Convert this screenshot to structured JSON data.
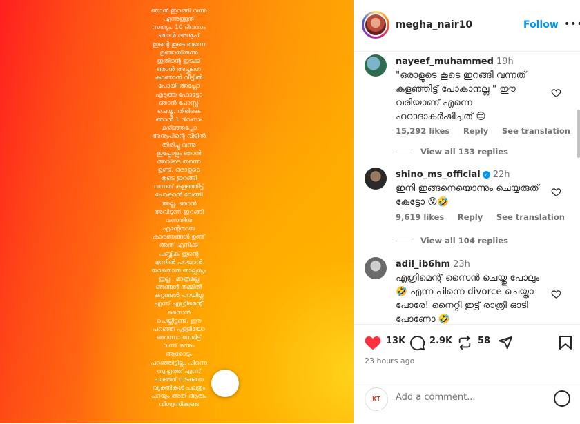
{
  "post_text_lines": [
    "ഞാൻ ഇറങ്ങി വന്നു",
    "എന്നുള്ളത്",
    "സത്യം. 10 ദിവസം",
    "ഞാൻ അനൂപ്",
    "ഇന്റെ കൂടെ തന്നെ",
    "ഉണ്ടായിരുന്നു",
    "ഇതിന്റെ ഇടക്ക്",
    "ഞാൻ അച്ഛനെ",
    "കാണാൻ വീട്ടിൽ",
    "പോയി അപ്പോ",
    "എടുത്ത ഫോട്ടോ",
    "ഞാൻ പോസ്റ്റ്",
    "ചെയ്തു. തിരികെ",
    "ഞാൻ 1 ദിവസം",
    "കഴിഞ്ഞപ്പോ",
    "അനൂപിന്റെ വീട്ടിൽ",
    "തിരിച്ചു വന്നു",
    "ഇപ്പോളും ഞാൻ",
    "അവിടെ തന്നെ",
    "ഉണ്ട്. ഒരാളുടെ",
    "കൂടെ ഇറങ്ങി",
    "വന്നത് കളഞ്ഞിട്ട്",
    "പോകാൻ വേണ്ടി",
    "അല്ല. ഞാൻ",
    "അവിടുന്ന് ഇറങ്ങി",
    "വന്നതിനു",
    "എന്റേതായ",
    "കാരണങ്ങൾ ഉണ്ട്",
    "അത് എനിക്ക്",
    "പബ്ലിക് ഇന്റെ",
    "മുന്നിൽ പറയാൻ",
    "യാതൊരു താല്പര്യം",
    "ഇല്ല . മാത്രമല്ല",
    "ഞങ്ങൾ തമ്മിൽ",
    "കുറ്റങ്ങൾ പറയില്ല",
    "എന്ന് എഗ്രിമെന്റ്",
    "സൈൻ",
    "ചെയ്തിട്ടുണ്ട്. ഈ",
    "പറഞ്ഞ പുള്ളിയോ",
    "ഞാനോ നേരിട്ട്",
    "വന്ന് ഒന്നും",
    "ആരോടും",
    "പറഞ്ഞിട്ടില്ല. പിന്നെ",
    "സുഹൃത്ത് എന്ന്",
    "പറഞ്ഞ് നടക്കുന്ന",
    "വ്യക്തികൾ പലതും",
    "പറയും അത് ആരും",
    "വിശ്വസിക്കണ്ട"
  ],
  "header": {
    "username": "megha_nair10",
    "follow_label": "Follow",
    "more_label": "•••"
  },
  "comments": [
    {
      "username": "nayeef_muhammed",
      "time": "19h",
      "text": "\"ഒരാളുടെ കൂടെ ഇറങ്ങി വന്നത് കളഞ്ഞിട്ട് പോകാനല്ല \" ഈ വരിയാണ് എന്നെ ഹഠാദാകർഷിച്ചത് 😑",
      "likes": "15,292 likes",
      "reply_label": "Reply",
      "translate_label": "See translation",
      "view_replies": "View all 133 replies"
    },
    {
      "username": "shino_ms_official",
      "time": "22h",
      "text": "ഇനി ഇങ്ങനെയൊന്നും ചെയ്യരുത് കേട്ടോ 😵🤣",
      "likes": "9,619 likes",
      "reply_label": "Reply",
      "translate_label": "See translation",
      "view_replies": "View all 104 replies"
    },
    {
      "username": "adil_ib6hm",
      "time": "23h",
      "text": "എഗ്രിമെന്റ് സൈൻ ചെയ്തു പോലും 🤣 എന്ന പിന്നെ divorce ചെയ്താ പോരേ! നൈറ്റി ഇട്ട് രാത്രി ഓടി പോണോ 🤣"
    }
  ],
  "actions": {
    "like_count": "13K",
    "comment_count": "2.9K",
    "repost_count": "58"
  },
  "time_ago": "23 hours ago",
  "add_comment_placeholder": "Add a comment...",
  "commenter_avatar_text": "KT",
  "colors": {
    "accent": "#0095f6",
    "like": "#ff3040",
    "text": "#262626",
    "muted": "#737373"
  }
}
